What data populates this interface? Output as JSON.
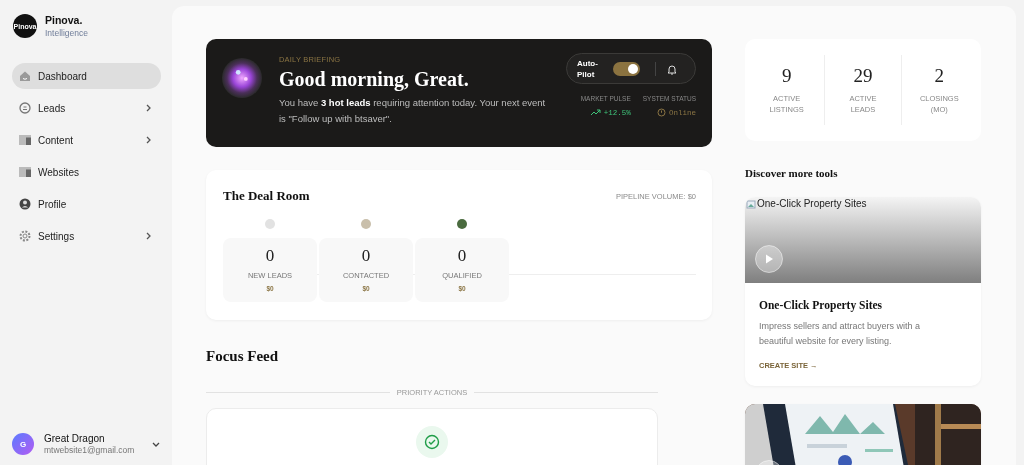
{
  "sidebar": {
    "brand": {
      "logo_text": "Pinova",
      "name": "Pinova.",
      "tagline": "Intelligence"
    },
    "items": [
      {
        "label": "Dashboard",
        "kind": "home",
        "selected": true,
        "expandable": false
      },
      {
        "label": "Leads",
        "kind": "face",
        "selected": false,
        "expandable": true
      },
      {
        "label": "Content",
        "kind": "panel",
        "selected": false,
        "expandable": true
      },
      {
        "label": "Websites",
        "kind": "panel",
        "selected": false,
        "expandable": false
      },
      {
        "label": "Profile",
        "kind": "user",
        "selected": false,
        "expandable": false
      },
      {
        "label": "Settings",
        "kind": "gear",
        "selected": false,
        "expandable": true
      }
    ],
    "user": {
      "initial": "G",
      "name": "Great Dragon",
      "email": "mtwebsite1@gmail.com"
    }
  },
  "briefing": {
    "eyebrow": "DAILY BRIEFING",
    "headline": "Good morning, Great.",
    "message": "You have **3 hot leads** requiring attention today. Your next event is \"Follow up with btsaver\".",
    "autopilot": {
      "label": "Auto-Pilot",
      "on": true
    },
    "metrics": [
      {
        "kind": "trend",
        "label": "MARKET PULSE",
        "value": "+12.5%"
      },
      {
        "kind": "status",
        "label": "SYSTEM STATUS",
        "value": "Online"
      }
    ]
  },
  "deal_room": {
    "title": "The Deal Room",
    "pipeline_volume": "PIPELINE VOLUME: $0",
    "stages": [
      {
        "count": "0",
        "label": "NEW LEADS",
        "amount": "$0",
        "color": "#e2e2e2"
      },
      {
        "count": "0",
        "label": "CONTACTED",
        "amount": "$0",
        "color": "#c9bfab"
      },
      {
        "count": "0",
        "label": "QUALIFIED",
        "amount": "$0",
        "color": "#4a6b3f"
      }
    ]
  },
  "focus_feed": {
    "title": "Focus Feed",
    "section": "PRIORITY ACTIONS"
  },
  "stats": [
    {
      "value": "9",
      "label": "ACTIVE LISTINGS"
    },
    {
      "value": "29",
      "label": "ACTIVE LEADS"
    },
    {
      "value": "2",
      "label": "CLOSINGS (MO)"
    }
  ],
  "tools": {
    "title": "Discover more tools",
    "cards": [
      {
        "kind": "broken",
        "image_alt": "One-Click Property Sites",
        "title": "One-Click Property Sites",
        "description": "Impress sellers and attract buyers with a beautiful website for every listing.",
        "link": "CREATE SITE →"
      },
      {
        "kind": "picture"
      }
    ]
  }
}
